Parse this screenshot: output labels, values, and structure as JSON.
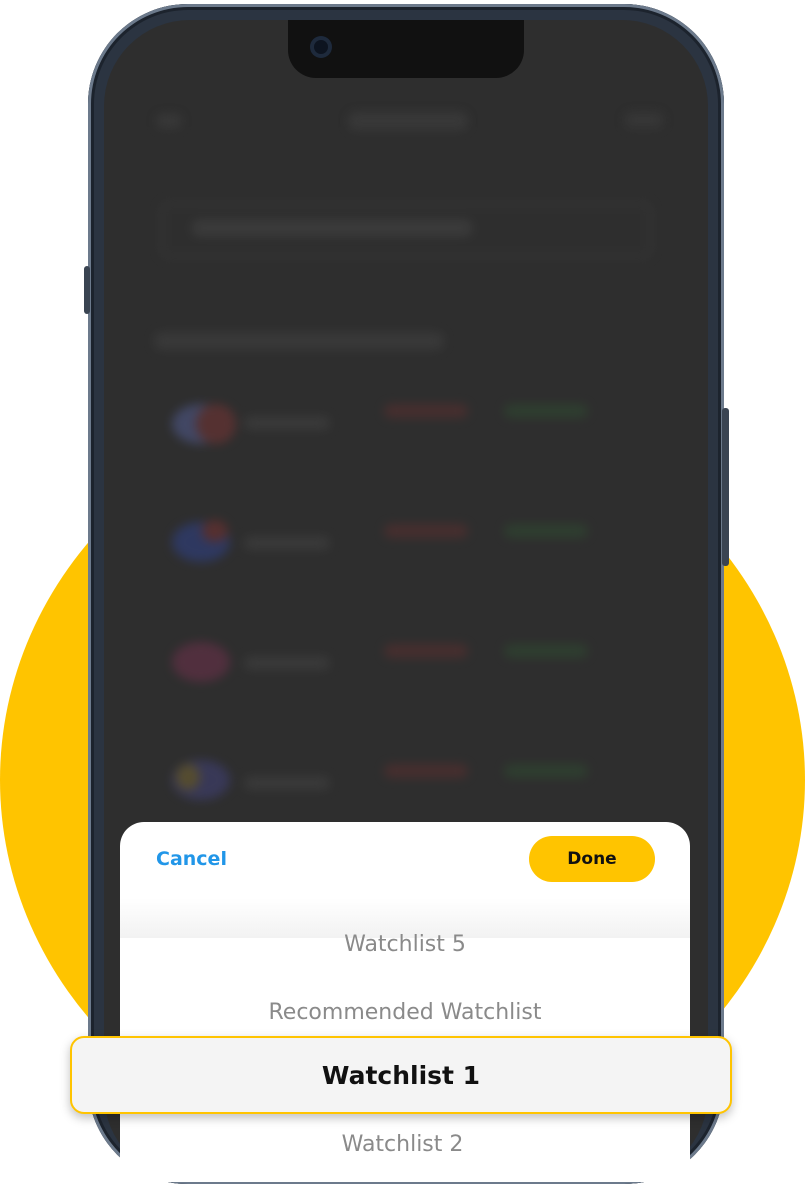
{
  "sheet": {
    "cancel_label": "Cancel",
    "done_label": "Done"
  },
  "picker": {
    "items": [
      "Watchlist 5",
      "Recommended Watchlist",
      "Watchlist 1",
      "Watchlist 2"
    ],
    "selected": "Watchlist 1"
  },
  "colors": {
    "accent_yellow": "#FFC400",
    "cancel_blue": "#2196e8"
  }
}
